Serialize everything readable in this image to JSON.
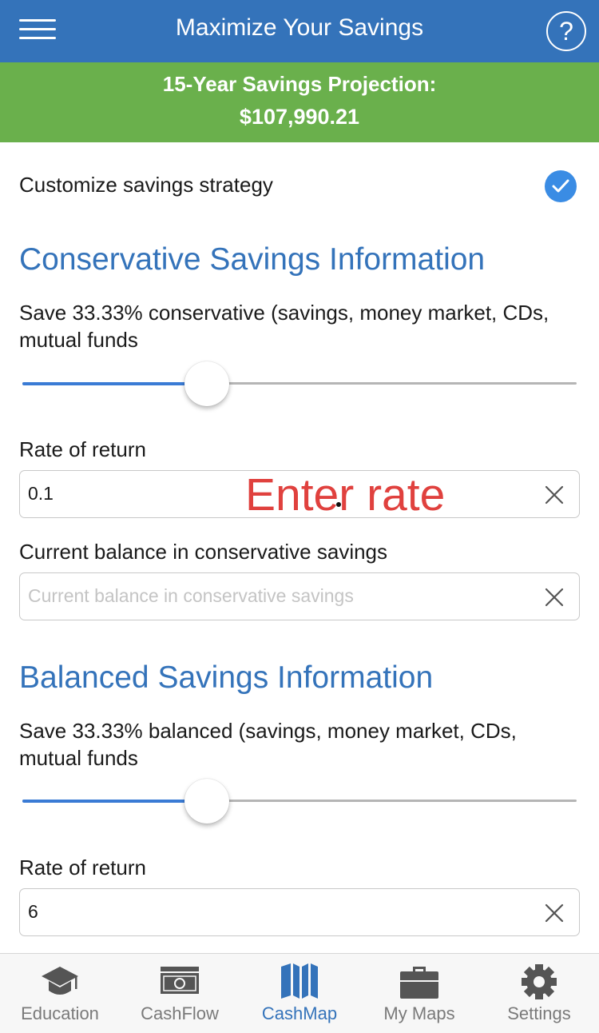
{
  "header": {
    "title": "Maximize Your Savings",
    "help_label": "?"
  },
  "banner": {
    "line1": "15-Year Savings Projection:",
    "line2": "$107,990.21"
  },
  "customize": {
    "label": "Customize savings strategy",
    "checked": true
  },
  "conservative": {
    "title": "Conservative Savings Information",
    "description": "Save 33.33% conservative (savings, money market, CDs, mutual funds",
    "slider_fraction": 0.3333,
    "rate_label": "Rate of return",
    "rate_value": "0.1",
    "balance_label": "Current balance in conservative savings",
    "balance_value": "",
    "balance_placeholder": "Current balance in conservative savings"
  },
  "annotation": {
    "text": "Enter rate"
  },
  "balanced": {
    "title": "Balanced Savings Information",
    "description": "Save 33.33% balanced (savings, money market, CDs, mutual funds",
    "slider_fraction": 0.3333,
    "rate_label": "Rate of return",
    "rate_value": "6"
  },
  "tabs": [
    {
      "label": "Education",
      "icon": "graduation-cap-icon",
      "active": false
    },
    {
      "label": "CashFlow",
      "icon": "banknote-icon",
      "active": false
    },
    {
      "label": "CashMap",
      "icon": "map-icon",
      "active": true
    },
    {
      "label": "My Maps",
      "icon": "briefcase-icon",
      "active": false
    },
    {
      "label": "Settings",
      "icon": "gear-icon",
      "active": false
    }
  ],
  "colors": {
    "header": "#3473ba",
    "banner": "#6ab04c",
    "accent": "#3a8ce4",
    "annotation": "#e0413e",
    "tab_active": "#3473ba",
    "tab_inactive": "#7a7a7a"
  }
}
